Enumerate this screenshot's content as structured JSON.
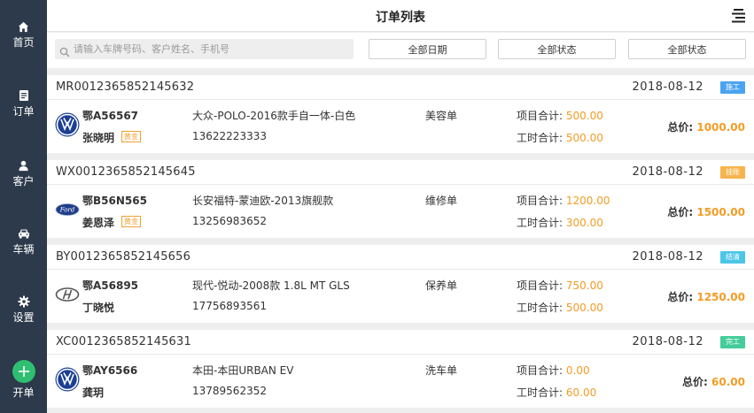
{
  "sidebar": {
    "items": [
      {
        "label": "首页",
        "icon": "home-icon"
      },
      {
        "label": "订单",
        "icon": "document-icon"
      },
      {
        "label": "客户",
        "icon": "user-icon"
      },
      {
        "label": "车辆",
        "icon": "car-icon"
      },
      {
        "label": "设置",
        "icon": "gear-icon"
      },
      {
        "label": "开单",
        "icon": "plus-icon"
      }
    ]
  },
  "header": {
    "title": "订单列表",
    "menu_icon": "menu-icon"
  },
  "filters": {
    "search_placeholder": "请输入车牌号码、客户姓名、手机号",
    "date_label": "全部日期",
    "status1_label": "全部状态",
    "status2_label": "全部状态"
  },
  "labels": {
    "items_total": "项目合计:",
    "labor_total": "工时合计:",
    "total": "总价:"
  },
  "orders": [
    {
      "order_no": "MR0012365852145632",
      "date": "2018-08-12",
      "status": "施工",
      "status_color": "#4aa3f0",
      "brand_icon": "volkswagen-logo",
      "plate": "鄂A56567",
      "owner": "张晓明",
      "vip_tag": "黄金",
      "car": "大众-POLO-2016款手自一体-白色",
      "phone": "13622223333",
      "type": "美容单",
      "items_total": "500.00",
      "labor_total": "500.00",
      "total": "1000.00"
    },
    {
      "order_no": "WX0012365852145645",
      "date": "2018-08-12",
      "status": "挂账",
      "status_color": "#f6b44e",
      "brand_icon": "ford-logo",
      "plate": "鄂B56N565",
      "owner": "姜恩泽",
      "vip_tag": "黄金",
      "car": "长安福特-蒙迪欧-2013旗舰款",
      "phone": "13256983652",
      "type": "维修单",
      "items_total": "1200.00",
      "labor_total": "300.00",
      "total": "1500.00"
    },
    {
      "order_no": "BY0012365852145656",
      "date": "2018-08-12",
      "status": "结清",
      "status_color": "#4cc6e8",
      "brand_icon": "hyundai-logo",
      "plate": "鄂A56895",
      "owner": "丁晓悦",
      "vip_tag": "",
      "car": "现代-悦动-2008款 1.8L MT GLS",
      "phone": "17756893561",
      "type": "保养单",
      "items_total": "750.00",
      "labor_total": "500.00",
      "total": "1250.00"
    },
    {
      "order_no": "XC0012365852145631",
      "date": "2018-08-12",
      "status": "完工",
      "status_color": "#44cc9a",
      "brand_icon": "volkswagen-logo",
      "plate": "鄂AY6566",
      "owner": "龚玥",
      "vip_tag": "",
      "car": "本田-本田URBAN EV",
      "phone": "13789562352",
      "type": "洗车单",
      "items_total": "0.00",
      "labor_total": "60.00",
      "total": "60.00"
    }
  ]
}
